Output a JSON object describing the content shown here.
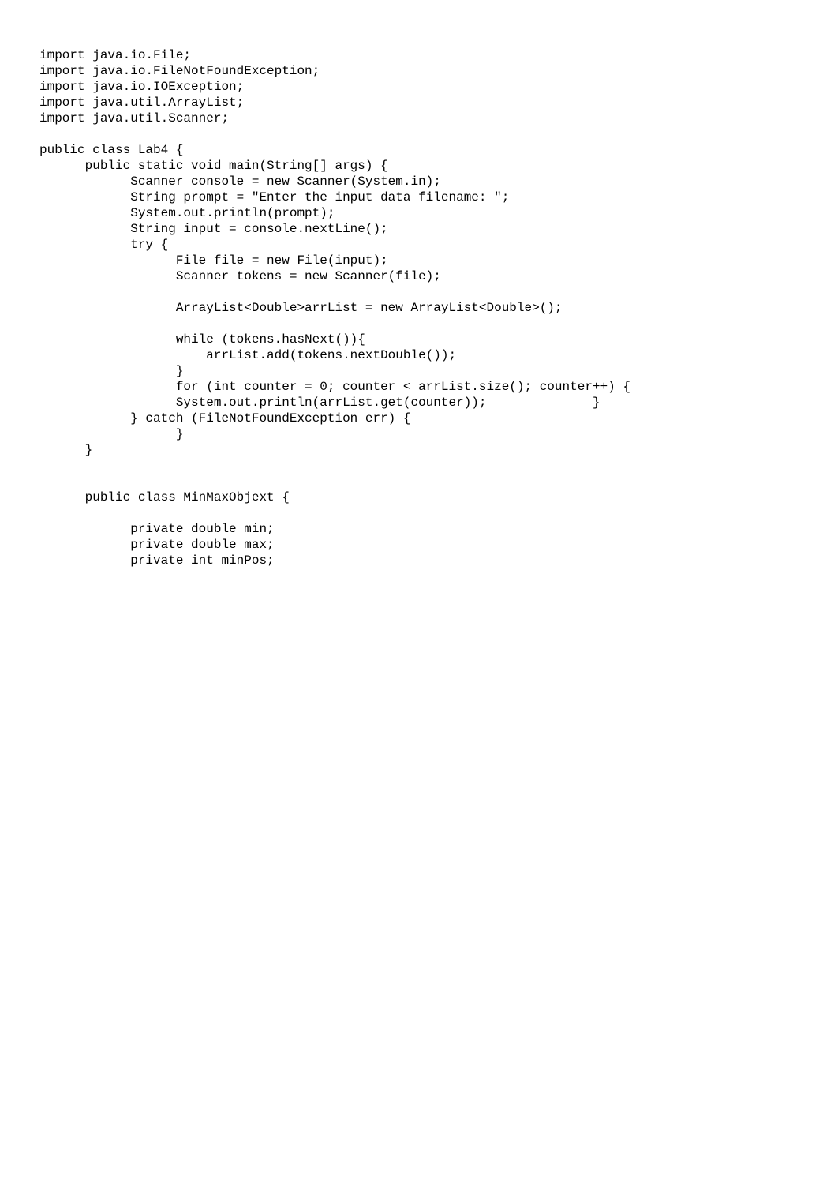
{
  "code": {
    "lines": [
      "import java.io.File;",
      "import java.io.FileNotFoundException;",
      "import java.io.IOException;",
      "import java.util.ArrayList;",
      "import java.util.Scanner;",
      "",
      "public class Lab4 {",
      "      public static void main(String[] args) {",
      "            Scanner console = new Scanner(System.in);",
      "            String prompt = \"Enter the input data filename: \";",
      "            System.out.println(prompt);",
      "            String input = console.nextLine();",
      "            try {",
      "                  File file = new File(input);",
      "                  Scanner tokens = new Scanner(file);",
      "",
      "                  ArrayList<Double>arrList = new ArrayList<Double>();",
      "",
      "                  while (tokens.hasNext()){",
      "                      arrList.add(tokens.nextDouble());",
      "                  }",
      "                  for (int counter = 0; counter < arrList.size(); counter++) {",
      "                  System.out.println(arrList.get(counter));              }",
      "            } catch (FileNotFoundException err) {",
      "                  }",
      "      }",
      "",
      "",
      "      public class MinMaxObjext {",
      "",
      "            private double min;",
      "            private double max;",
      "            private int minPos;"
    ]
  }
}
